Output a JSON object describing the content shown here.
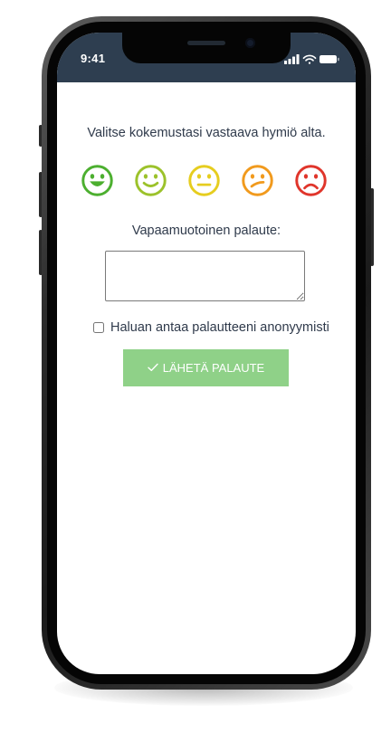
{
  "status_bar": {
    "time": "9:41",
    "icons": [
      "signal-icon",
      "wifi-icon",
      "battery-icon"
    ]
  },
  "feedback_form": {
    "prompt": "Valitse kokemustasi vastaava hymiö alta.",
    "faces": [
      {
        "icon": "very-happy-face-icon",
        "color": "#4caf2f"
      },
      {
        "icon": "happy-face-icon",
        "color": "#9cc22b"
      },
      {
        "icon": "neutral-face-icon",
        "color": "#e6cd1f"
      },
      {
        "icon": "unsure-face-icon",
        "color": "#f19a1d"
      },
      {
        "icon": "sad-face-icon",
        "color": "#e0352b"
      }
    ],
    "free_text_label": "Vapaamuotoinen palaute:",
    "free_text_value": "",
    "anonymous_label": "Haluan antaa palautteeni anonyymisti",
    "anonymous_checked": false,
    "submit_label": "LÄHETÄ PALAUTE",
    "submit_icon": "check-icon",
    "colors": {
      "status_bar": "#2e3e50",
      "text": "#2f3a4b",
      "submit_button": "#8fd188"
    }
  }
}
